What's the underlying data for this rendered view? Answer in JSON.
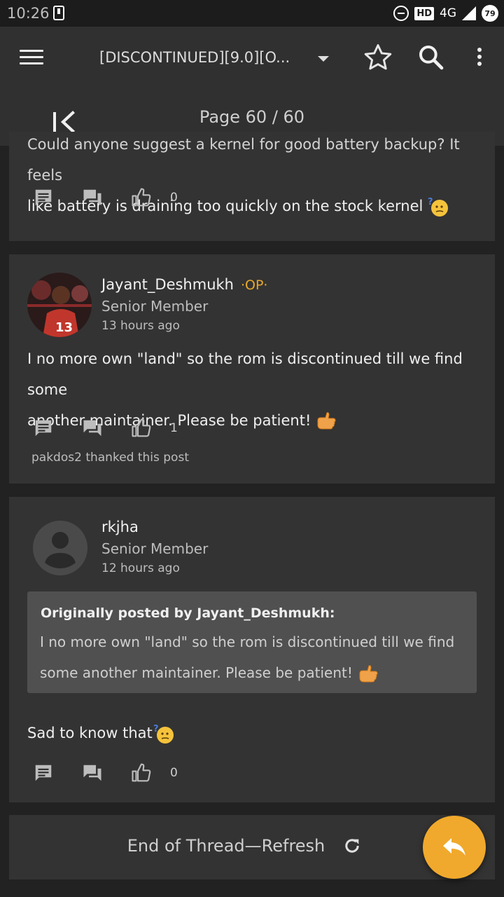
{
  "status_bar": {
    "time": "10:26",
    "network": "4G",
    "hd": "HD",
    "battery": "79"
  },
  "app_bar": {
    "title": "[DISCONTINUED][9.0][O...",
    "page_indicator": "Page 60 / 60"
  },
  "posts": [
    {
      "text_lines": [
        "Could anyone suggest a kernel for good battery backup? It feels",
        "like battery is draining too quickly on the stock kernel"
      ],
      "likes": "0"
    },
    {
      "username": "Jayant_Deshmukh",
      "badge": "·OP·",
      "role": "Senior Member",
      "time": "13 hours ago",
      "text_lines": [
        "I no more own \"land\" so the rom is discontinued till we find some",
        "another maintainer. Please be patient!"
      ],
      "likes": "1",
      "thanks": "pakdos2 thanked this post"
    },
    {
      "username": "rkjha",
      "role": "Senior Member",
      "time": "12 hours ago",
      "quote_header": "Originally posted by Jayant_Deshmukh:",
      "quote_lines": [
        "I no more own \"land\" so the rom is discontinued till we find",
        "some another maintainer. Please be patient!"
      ],
      "text": "Sad to know that",
      "likes": "0"
    }
  ],
  "footer": {
    "end_label": "End of Thread—Refresh"
  },
  "colors": {
    "accent": "#f0a92c",
    "op_badge": "#e8a82a",
    "card": "#333333",
    "background": "#222222"
  }
}
